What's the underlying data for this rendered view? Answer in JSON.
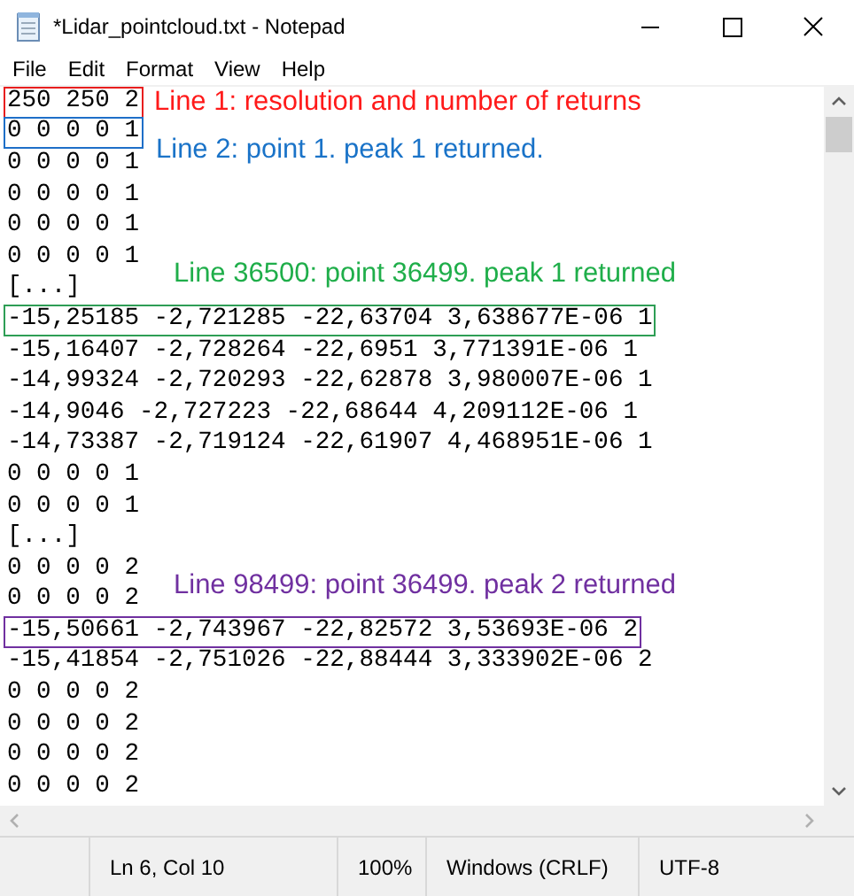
{
  "window": {
    "title": "*Lidar_pointcloud.txt - Notepad"
  },
  "menu": [
    "File",
    "Edit",
    "Format",
    "View",
    "Help"
  ],
  "lines": [
    {
      "text": "250 250 2",
      "color": "#e81e1e",
      "note": {
        "text": "Line 1: resolution and number of returns",
        "color": "#ff1a1a",
        "kind": "inline"
      }
    },
    {
      "text": "0 0 0 0 1",
      "color": "#1e6fc8",
      "note": {
        "text": "Line 2: point 1. peak 1 returned.",
        "color": "#1a73c8",
        "kind": "between"
      }
    },
    {
      "text": "0 0 0 0 1"
    },
    {
      "text": "0 0 0 0 1"
    },
    {
      "text": "0 0 0 0 1"
    },
    {
      "text": "0 0 0 0 1",
      "note": {
        "text": "Line 36500: point 36499. peak 1 returned",
        "color": "#1fae4a",
        "kind": "between"
      }
    },
    {
      "text": "[...]"
    },
    {
      "text": "-15,25185 -2,721285 -22,63704 3,638677E-06 1",
      "color": "#2e9e55"
    },
    {
      "text": "-15,16407 -2,728264 -22,6951 3,771391E-06 1"
    },
    {
      "text": "-14,99324 -2,720293 -22,62878 3,980007E-06 1"
    },
    {
      "text": "-14,9046 -2,727223 -22,68644 4,209112E-06 1"
    },
    {
      "text": "-14,73387 -2,719124 -22,61907 4,468951E-06 1"
    },
    {
      "text": "0 0 0 0 1"
    },
    {
      "text": "0 0 0 0 1"
    },
    {
      "text": "[...]"
    },
    {
      "text": "0 0 0 0 2",
      "note": {
        "text": "Line 98499: point 36499. peak 2 returned",
        "color": "#7030a0",
        "kind": "between"
      }
    },
    {
      "text": "0 0 0 0 2"
    },
    {
      "text": "-15,50661 -2,743967 -22,82572 3,53693E-06 2",
      "color": "#7030a0"
    },
    {
      "text": "-15,41854 -2,751026 -22,88444 3,333902E-06 2"
    },
    {
      "text": "0 0 0 0 2"
    },
    {
      "text": "0 0 0 0 2"
    },
    {
      "text": "0 0 0 0 2"
    },
    {
      "text": "0 0 0 0 2"
    }
  ],
  "status_bar": [
    "Ln 6, Col 10",
    "100%",
    "Windows (CRLF)",
    "UTF-8"
  ]
}
